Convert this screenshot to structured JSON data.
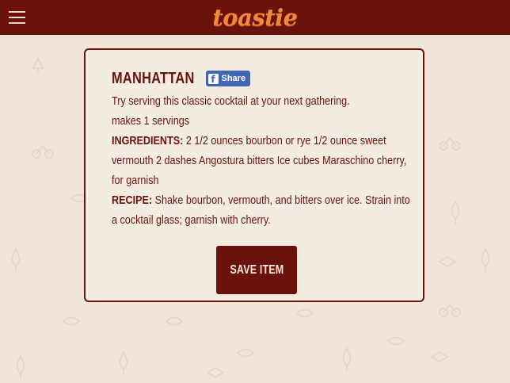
{
  "header": {
    "logo_text": "toastie",
    "menu_icon": "hamburger-menu-icon",
    "background_color": "#6b120c",
    "logo_color": "#f08a3a"
  },
  "recipe": {
    "title": "MANHATTAN",
    "share_label": "Share",
    "share_icon": "facebook-icon",
    "description": "Try serving this classic cocktail at your next gathering.",
    "servings": "makes 1 servings",
    "ingredients_label": "INGREDIENTS:",
    "ingredients": " 2 1/2 ounces bourbon or rye 1/2 ounce sweet vermouth 2 dashes Angostura bitters Ice cubes Maraschino cherry, for garnish",
    "recipe_label": "RECIPE:",
    "recipe_text": " Shake bourbon, vermouth, and bitters over ice. Strain into a cocktail glass; garnish with cherry.",
    "save_label": "SAVE ITEM",
    "accent_color": "#6b120c",
    "share_color": "#4267b2"
  },
  "page": {
    "background_color": "#efe6d7"
  }
}
